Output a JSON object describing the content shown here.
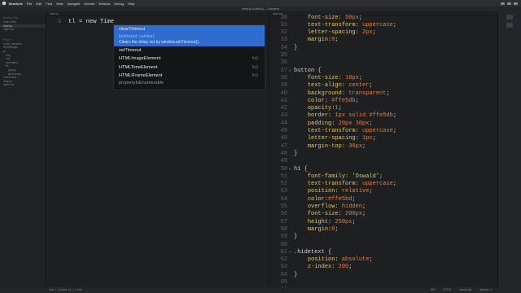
{
  "menubar": {
    "app": "Brackets",
    "items": [
      "File",
      "Edit",
      "Find",
      "View",
      "Navigate",
      "Emmet",
      "Window",
      "Debug",
      "Help"
    ]
  },
  "window": {
    "title": "index.js (Untitled) — Brackets"
  },
  "sidebar": {
    "section1": "Working Files",
    "working": [
      "index.html",
      "main.js",
      "style.css"
    ],
    "section2": "Project",
    "project": [
      "node_modules",
      "ScrollMagic",
      "js",
      "img",
      "css",
      "animation",
      "lib",
      "jquery",
      "greensock",
      "index.html",
      "main.js",
      "style.css"
    ]
  },
  "left_editor": {
    "header": "main.js",
    "line_number": "1",
    "line_text": "tl = new Time"
  },
  "hints": {
    "selected": "clearTimeout",
    "signature": "fn(timeout: number)",
    "description": "Clears the delay set by window.setTimeout().",
    "items": [
      {
        "label": "setTimeout",
        "type": ""
      },
      {
        "label": "HTMLImageElement",
        "type": "fn()"
      },
      {
        "label": "HTMLTimeElement",
        "type": "fn()"
      },
      {
        "label": "HTMLIFrameElement",
        "type": "fn()"
      }
    ],
    "partial": "propertyIsEnumerable"
  },
  "right_editor": {
    "header": "style.css",
    "lines": [
      {
        "n": "30",
        "code": [
          [
            "    ",
            ""
          ],
          [
            "font-size: ",
            "c-prop"
          ],
          [
            "50px",
            "c-num"
          ],
          [
            ";",
            "c-punc"
          ]
        ]
      },
      {
        "n": "31",
        "code": [
          [
            "    ",
            ""
          ],
          [
            "text-transform: ",
            "c-prop"
          ],
          [
            "uppercase",
            "c-val"
          ],
          [
            ";",
            "c-punc"
          ]
        ]
      },
      {
        "n": "32",
        "code": [
          [
            "    ",
            ""
          ],
          [
            "letter-spacing: ",
            "c-prop"
          ],
          [
            "2px",
            "c-num"
          ],
          [
            ";",
            "c-punc"
          ]
        ]
      },
      {
        "n": "33",
        "code": [
          [
            "    ",
            ""
          ],
          [
            "margin:",
            "c-prop"
          ],
          [
            "0",
            "c-num"
          ],
          [
            ";",
            "c-punc"
          ]
        ]
      },
      {
        "n": "34",
        "code": [
          [
            "}",
            "c-punc"
          ]
        ]
      },
      {
        "n": "35",
        "code": []
      },
      {
        "n": "36",
        "code": []
      },
      {
        "n": "37",
        "fold": true,
        "code": [
          [
            "button {",
            "c-sel"
          ]
        ]
      },
      {
        "n": "38",
        "code": [
          [
            "    ",
            ""
          ],
          [
            "font-size: ",
            "c-prop"
          ],
          [
            "18px",
            "c-num"
          ],
          [
            ";",
            "c-punc"
          ]
        ]
      },
      {
        "n": "39",
        "code": [
          [
            "    ",
            ""
          ],
          [
            "text-align: ",
            "c-prop"
          ],
          [
            "center",
            "c-val"
          ],
          [
            ";",
            "c-punc"
          ]
        ]
      },
      {
        "n": "40",
        "code": [
          [
            "    ",
            ""
          ],
          [
            "background: ",
            "c-prop"
          ],
          [
            "transparent",
            "c-val"
          ],
          [
            ";",
            "c-punc"
          ]
        ]
      },
      {
        "n": "41",
        "code": [
          [
            "    ",
            ""
          ],
          [
            "color: ",
            "c-prop"
          ],
          [
            "#ffe5db",
            "c-val"
          ],
          [
            ";",
            "c-punc"
          ]
        ]
      },
      {
        "n": "42",
        "code": [
          [
            "    ",
            ""
          ],
          [
            "opacity:",
            "c-prop"
          ],
          [
            "1",
            "c-num"
          ],
          [
            ";",
            "c-punc"
          ]
        ]
      },
      {
        "n": "43",
        "code": [
          [
            "    ",
            ""
          ],
          [
            "border: ",
            "c-prop"
          ],
          [
            "1px solid #ffe5db",
            "c-val"
          ],
          [
            ";",
            "c-punc"
          ]
        ]
      },
      {
        "n": "44",
        "code": [
          [
            "    ",
            ""
          ],
          [
            "padding: ",
            "c-prop"
          ],
          [
            "20px 30px",
            "c-num"
          ],
          [
            ";",
            "c-punc"
          ]
        ]
      },
      {
        "n": "45",
        "code": [
          [
            "    ",
            ""
          ],
          [
            "text-transform: ",
            "c-prop"
          ],
          [
            "uppercase",
            "c-val"
          ],
          [
            ";",
            "c-punc"
          ]
        ]
      },
      {
        "n": "46",
        "code": [
          [
            "    ",
            ""
          ],
          [
            "letter-spacing: ",
            "c-prop"
          ],
          [
            "1px",
            "c-num"
          ],
          [
            ";",
            "c-punc"
          ]
        ]
      },
      {
        "n": "47",
        "code": [
          [
            "    ",
            ""
          ],
          [
            "margin-top: ",
            "c-prop"
          ],
          [
            "30px",
            "c-num"
          ],
          [
            ";",
            "c-punc"
          ]
        ]
      },
      {
        "n": "48",
        "code": [
          [
            "}",
            "c-punc"
          ]
        ]
      },
      {
        "n": "49",
        "code": []
      },
      {
        "n": "50",
        "fold": true,
        "code": [
          [
            "h1 {",
            "c-sel"
          ]
        ]
      },
      {
        "n": "51",
        "code": [
          [
            "    ",
            ""
          ],
          [
            "font-family: ",
            "c-prop"
          ],
          [
            "'Oswald'",
            "c-str"
          ],
          [
            ";",
            "c-punc"
          ]
        ]
      },
      {
        "n": "52",
        "code": [
          [
            "    ",
            ""
          ],
          [
            "text-transform: ",
            "c-prop"
          ],
          [
            "uppercase",
            "c-val"
          ],
          [
            ";",
            "c-punc"
          ]
        ]
      },
      {
        "n": "53",
        "code": [
          [
            "    ",
            ""
          ],
          [
            "position: ",
            "c-prop"
          ],
          [
            "relative",
            "c-val"
          ],
          [
            ";",
            "c-punc"
          ]
        ]
      },
      {
        "n": "54",
        "code": [
          [
            "    ",
            ""
          ],
          [
            "color:",
            "c-prop"
          ],
          [
            "#ffe5bd",
            "c-val"
          ],
          [
            ";",
            "c-punc"
          ]
        ]
      },
      {
        "n": "55",
        "code": [
          [
            "    ",
            ""
          ],
          [
            "overflow: ",
            "c-prop"
          ],
          [
            "hidden",
            "c-val"
          ],
          [
            ";",
            "c-punc"
          ]
        ]
      },
      {
        "n": "56",
        "code": [
          [
            "    ",
            ""
          ],
          [
            "font-size: ",
            "c-prop"
          ],
          [
            "200px",
            "c-num"
          ],
          [
            ";",
            "c-punc"
          ]
        ]
      },
      {
        "n": "57",
        "code": [
          [
            "    ",
            ""
          ],
          [
            "height: ",
            "c-prop"
          ],
          [
            "250px",
            "c-num"
          ],
          [
            ";",
            "c-punc"
          ]
        ]
      },
      {
        "n": "58",
        "code": [
          [
            "    ",
            ""
          ],
          [
            "margin:",
            "c-prop"
          ],
          [
            "0",
            "c-num"
          ],
          [
            ";",
            "c-punc"
          ]
        ]
      },
      {
        "n": "59",
        "code": [
          [
            "}",
            "c-punc"
          ]
        ]
      },
      {
        "n": "60",
        "code": []
      },
      {
        "n": "61",
        "fold": true,
        "code": [
          [
            ".hidetext {",
            "c-class"
          ]
        ]
      },
      {
        "n": "62",
        "code": [
          [
            "    ",
            ""
          ],
          [
            "position: ",
            "c-prop"
          ],
          [
            "absolute",
            "c-val"
          ],
          [
            ";",
            "c-punc"
          ]
        ]
      },
      {
        "n": "63",
        "code": [
          [
            "    ",
            ""
          ],
          [
            "z-index: ",
            "c-prop"
          ],
          [
            "200",
            "c-num"
          ],
          [
            ";",
            "c-punc"
          ]
        ]
      },
      {
        "n": "64",
        "code": [
          [
            "}",
            "c-punc"
          ]
        ]
      },
      {
        "n": "65",
        "code": []
      },
      {
        "n": "66",
        "code": []
      }
    ]
  },
  "statusbar": {
    "left": "Line 1, Column 14 — 1 Line",
    "right": [
      "INS",
      "UTF-8",
      "JavaScript",
      "Spaces: 4"
    ]
  }
}
